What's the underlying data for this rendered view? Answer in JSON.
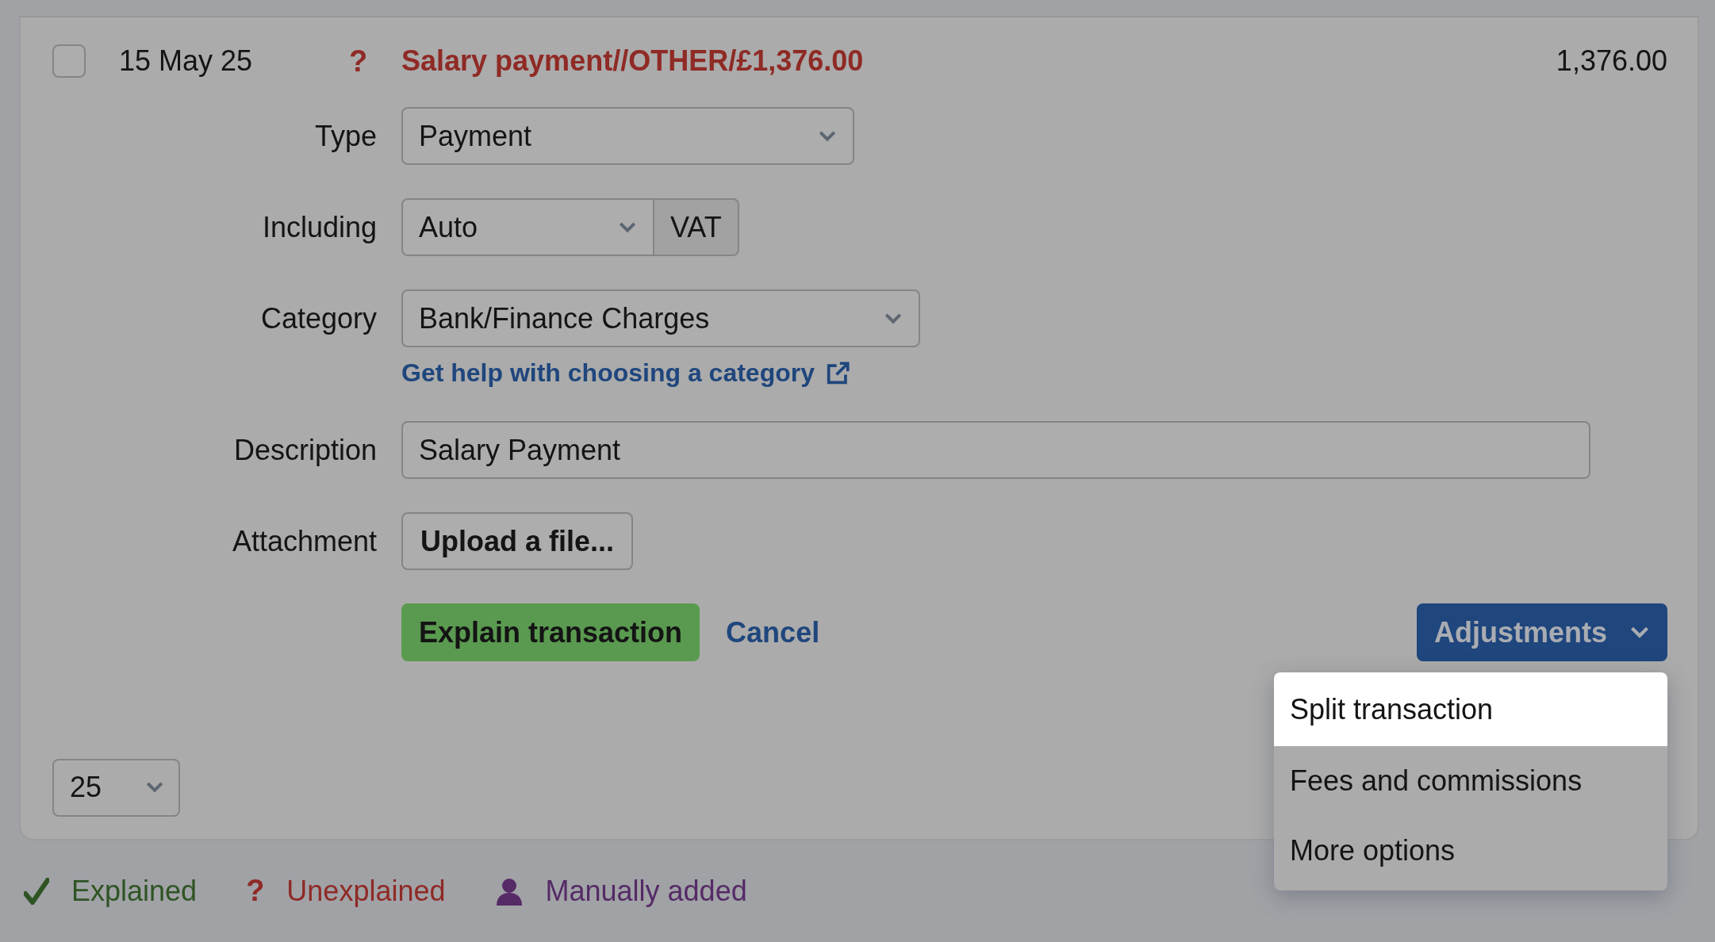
{
  "transaction": {
    "checked": false,
    "date": "15 May 25",
    "status_mark": "?",
    "title": "Salary payment//OTHER/£1,376.00",
    "amount": "1,376.00"
  },
  "form": [
    {
      "kind": "select",
      "label": "Type",
      "value": "Payment"
    },
    {
      "kind": "select_addon",
      "label": "Including",
      "value": "Auto",
      "addon": "VAT"
    },
    {
      "kind": "select",
      "label": "Category",
      "value": "Bank/Finance Charges",
      "help_link": "Get help with choosing a category"
    },
    {
      "kind": "text",
      "label": "Description",
      "value": "Salary Payment"
    },
    {
      "kind": "upload",
      "label": "Attachment",
      "button": "Upload a file..."
    }
  ],
  "actions": {
    "primary": "Explain transaction",
    "cancel": "Cancel",
    "menu_button": "Adjustments",
    "menu": [
      {
        "label": "Split transaction",
        "selected": true
      },
      {
        "label": "Fees and commissions",
        "selected": false
      },
      {
        "label": "More options",
        "selected": false
      }
    ]
  },
  "page_size": "25",
  "legend": [
    {
      "kind": "explained",
      "label": "Explained",
      "color": "#2f5424"
    },
    {
      "kind": "unexplained",
      "mark": "?",
      "label": "Unexplained",
      "color": "#8f2a25"
    },
    {
      "kind": "manual",
      "label": "Manually added",
      "color": "#552a66"
    }
  ]
}
